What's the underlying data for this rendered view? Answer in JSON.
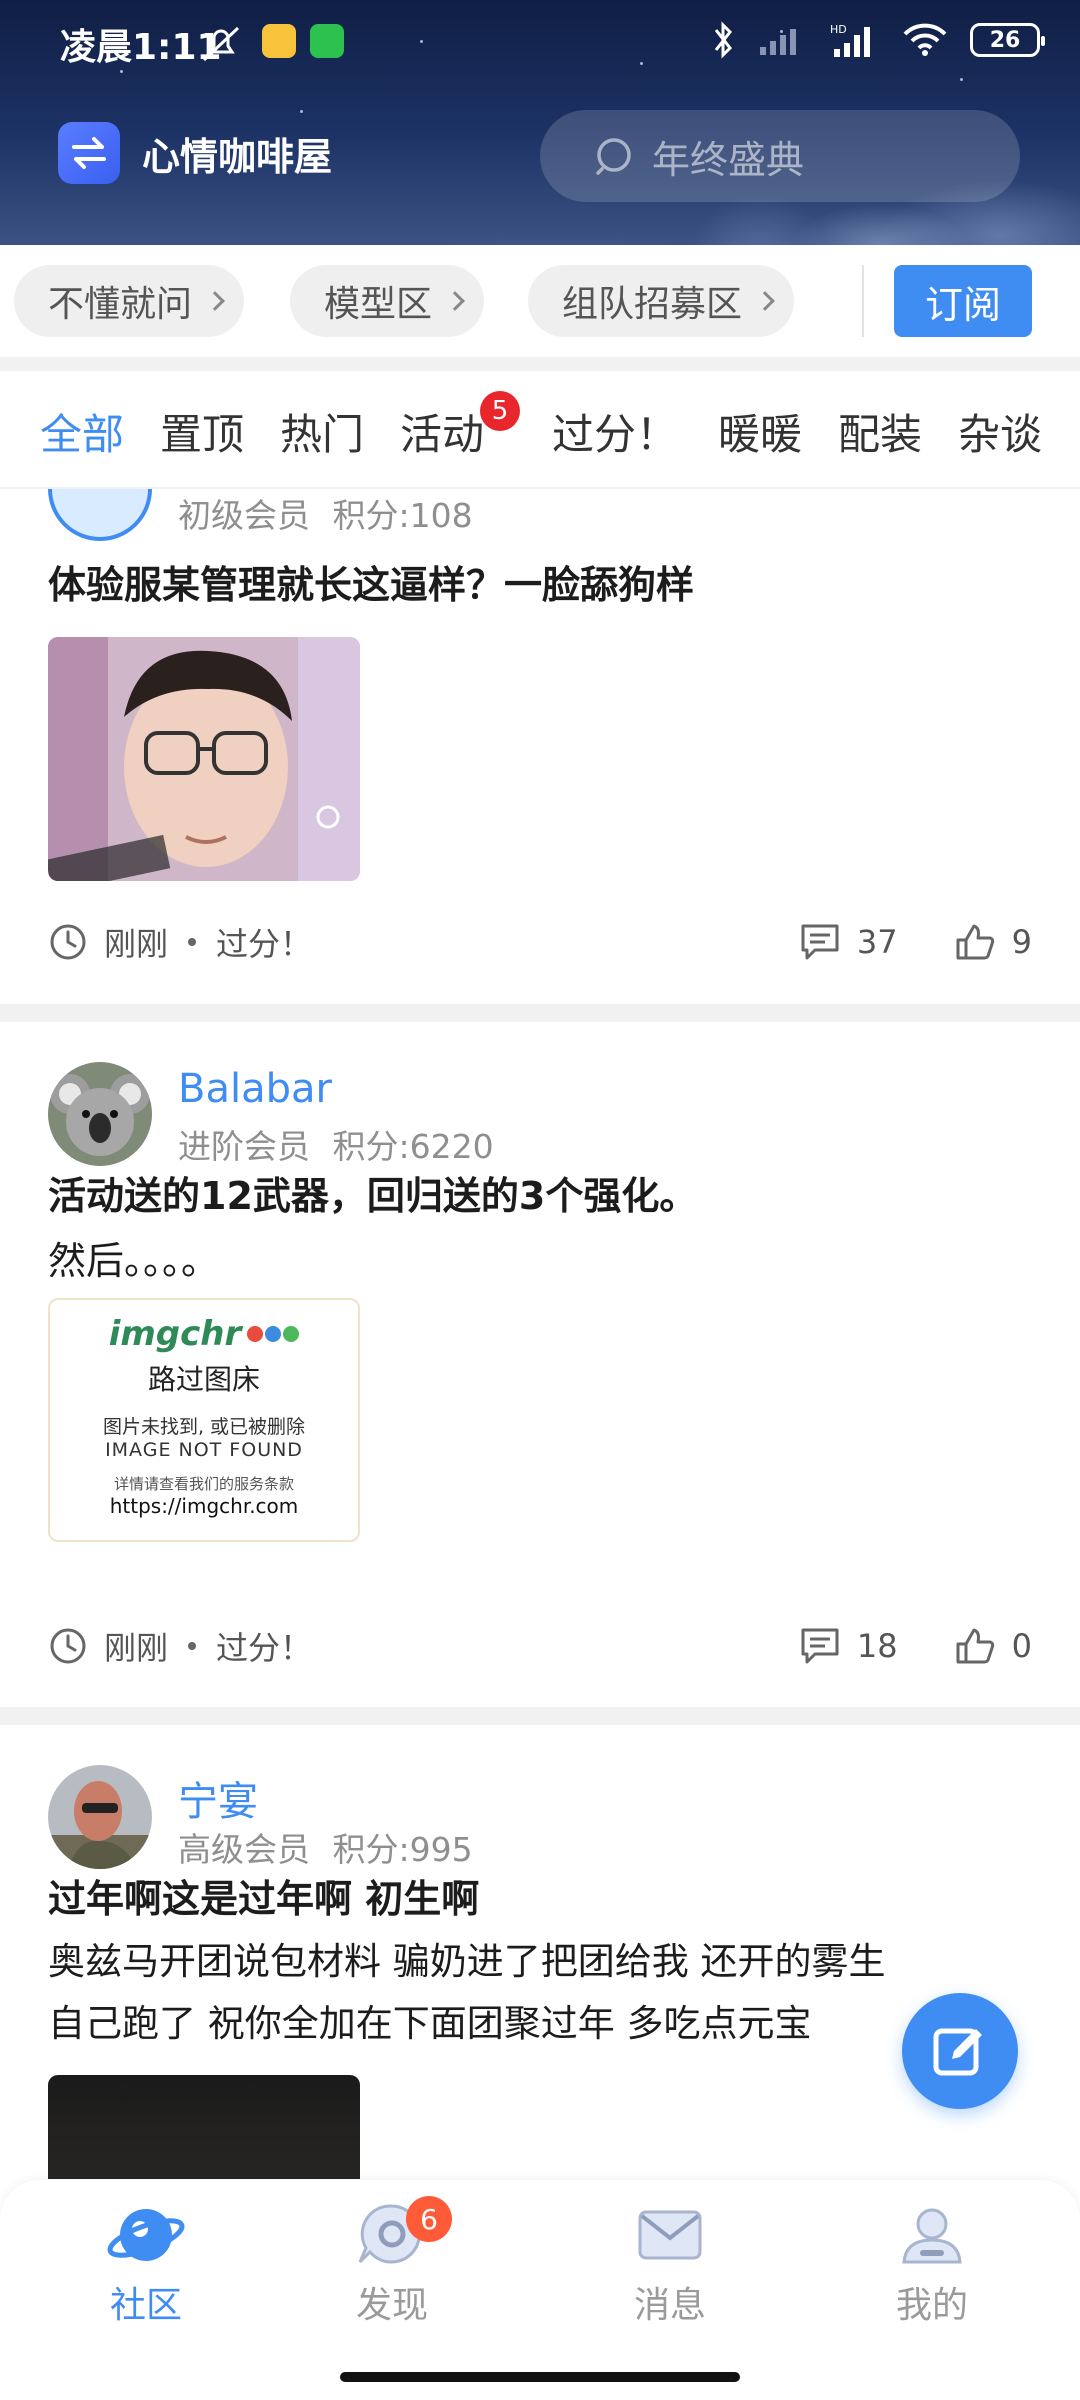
{
  "status_bar": {
    "time": "凌晨1:11",
    "battery": "26"
  },
  "header": {
    "forum_name": "心情咖啡屋",
    "search_placeholder": "年终盛典"
  },
  "zones": {
    "chips": [
      "不懂就问",
      "模型区",
      "组队招募区"
    ],
    "subscribe_label": "订阅"
  },
  "tabs": {
    "items": [
      "全部",
      "置顶",
      "热门",
      "活动",
      "过分！",
      "暖暖",
      "配装",
      "杂谈"
    ],
    "active": "全部",
    "activity_badge": "5"
  },
  "posts": [
    {
      "user_level": "初级会员",
      "points": "积分:108",
      "title": "体验服某管理就长这逼样？一脸舔狗样",
      "time": "刚刚",
      "category": "过分！",
      "comments": "37",
      "likes": "9"
    },
    {
      "username": "Balabar",
      "user_level": "进阶会员",
      "points": "积分:6220",
      "title": "活动送的12武器，回归送的3个强化。",
      "body": "然后。。。。",
      "image": {
        "logo": "imgchr",
        "line1": "路过图床",
        "line2": "图片未找到, 或已被删除",
        "line3": "IMAGE NOT FOUND",
        "line4": "详情请查看我们的服务条款",
        "line5": "https://imgchr.com"
      },
      "time": "刚刚",
      "category": "过分！",
      "comments": "18",
      "likes": "0"
    },
    {
      "username": "宁宴",
      "user_level": "高级会员",
      "points": "积分:995",
      "title": "过年啊这是过年啊 初生啊",
      "body_line1": "奥兹马开团说包材料 骗奶进了把团给我 还开的雾生",
      "body_line2": "自己跑了 祝你全加在下面团聚过年 多吃点元宝"
    }
  ],
  "bottom_nav": {
    "items": [
      "社区",
      "发现",
      "消息",
      "我的"
    ],
    "discover_badge": "6"
  },
  "colors": {
    "accent": "#3f8cf3",
    "badge_red": "#e8262b",
    "nav_badge": "#ff5b38",
    "header_bg": "#1d3366"
  }
}
